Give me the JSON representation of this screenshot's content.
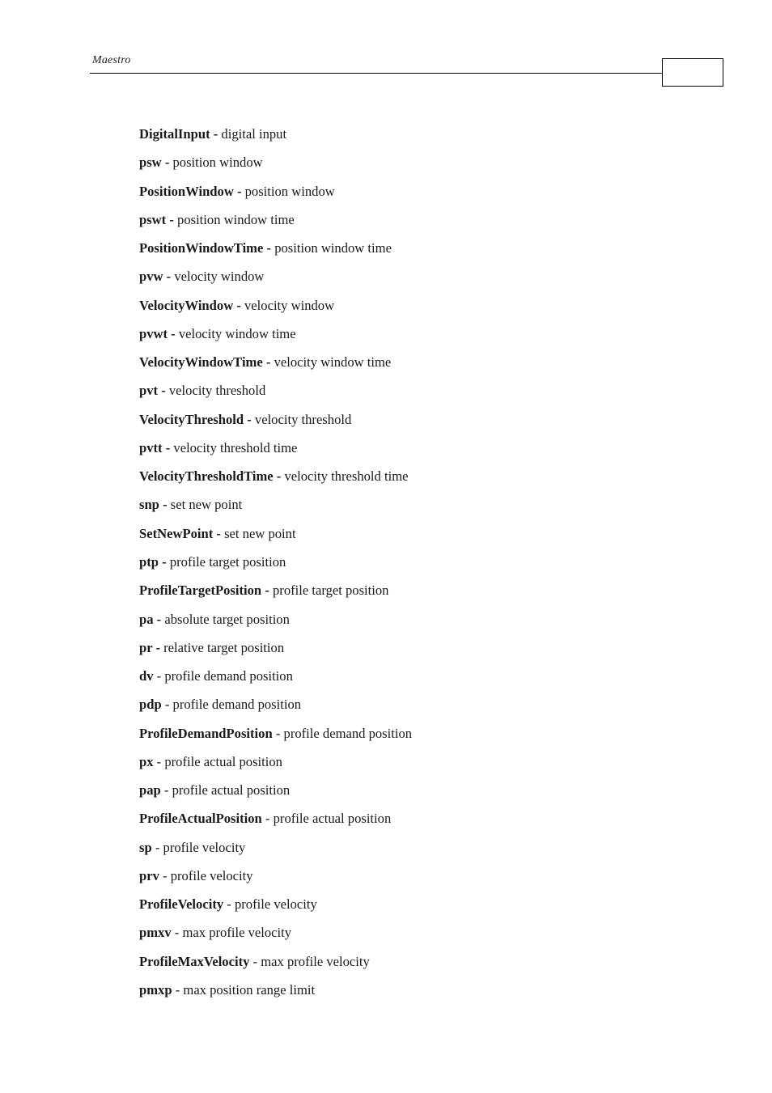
{
  "header": {
    "title": "Maestro",
    "page_number": ""
  },
  "entries": [
    {
      "term": "DigitalInput -",
      "sep": "",
      "desc": " digital input"
    },
    {
      "term": "psw -",
      "sep": "",
      "desc": " position window"
    },
    {
      "term": "PositionWindow -",
      "sep": "",
      "desc": " position window"
    },
    {
      "term": "pswt -",
      "sep": "",
      "desc": " position window time"
    },
    {
      "term": "PositionWindowTime -",
      "sep": "",
      "desc": " position window time"
    },
    {
      "term": "pvw -",
      "sep": "",
      "desc": " velocity window"
    },
    {
      "term": "VelocityWindow -",
      "sep": "",
      "desc": " velocity window"
    },
    {
      "term": "pvwt -",
      "sep": "",
      "desc": " velocity window time"
    },
    {
      "term": "VelocityWindowTime -",
      "sep": "",
      "desc": " velocity window time"
    },
    {
      "term": "pvt -",
      "sep": "",
      "desc": " velocity threshold"
    },
    {
      "term": "VelocityThreshold -",
      "sep": "",
      "desc": " velocity threshold"
    },
    {
      "term": "pvtt -",
      "sep": "",
      "desc": " velocity threshold time"
    },
    {
      "term": "VelocityThresholdTime -",
      "sep": "",
      "desc": " velocity threshold time"
    },
    {
      "term": "snp -",
      "sep": "",
      "desc": " set new point"
    },
    {
      "term": "SetNewPoint -",
      "sep": "",
      "desc": " set new point"
    },
    {
      "term": "ptp -",
      "sep": "",
      "desc": " profile target position"
    },
    {
      "term": "ProfileTargetPosition -",
      "sep": "",
      "desc": " profile target position"
    },
    {
      "term": "pa -",
      "sep": "",
      "desc": " absolute target position"
    },
    {
      "term": "pr -",
      "sep": "",
      "desc": " relative target position"
    },
    {
      "term": "dv",
      "sep": " - ",
      "desc": "profile demand position"
    },
    {
      "term": "pdp",
      "sep": " - ",
      "desc": "profile demand position"
    },
    {
      "term": "ProfileDemandPosition",
      "sep": " - ",
      "desc": "profile demand position"
    },
    {
      "term": "px",
      "sep": " - ",
      "desc": "profile actual position"
    },
    {
      "term": "pap",
      "sep": " - ",
      "desc": "profile actual position"
    },
    {
      "term": "ProfileActualPosition",
      "sep": " - ",
      "desc": "profile actual position"
    },
    {
      "term": "sp",
      "sep": " - ",
      "desc": "profile velocity"
    },
    {
      "term": "prv",
      "sep": " - ",
      "desc": "profile velocity"
    },
    {
      "term": "ProfileVelocity",
      "sep": " - ",
      "desc": "profile velocity"
    },
    {
      "term": "pmxv",
      "sep": " - ",
      "desc": "max profile velocity"
    },
    {
      "term": "ProfileMaxVelocity",
      "sep": " - ",
      "desc": "max profile velocity"
    },
    {
      "term": "pmxp",
      "sep": " - ",
      "desc": "max position range limit"
    }
  ]
}
